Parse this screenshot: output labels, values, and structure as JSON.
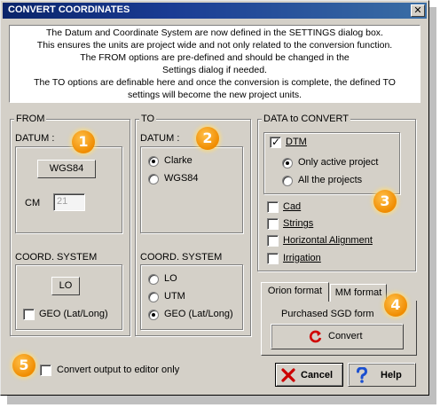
{
  "window": {
    "title": "CONVERT COORDINATES",
    "close_glyph": "✕"
  },
  "info": {
    "lines": [
      "The Datum and Coordinate System are now defined in the SETTINGS dialog box.",
      "This ensures the units are project wide and not only related to the conversion function.",
      "The FROM options are pre-defined and should be changed in the",
      "Settings dialog if needed.",
      "The TO options are definable here and once the conversion is complete, the defined TO",
      "settings will become the new project units."
    ]
  },
  "from": {
    "legend": "FROM",
    "datum_label": "DATUM :",
    "datum_button": "WGS84",
    "cm_label": "CM",
    "cm_value": "21",
    "coord_label": "COORD. SYSTEM",
    "coord_button": "LO",
    "geo_label": "GEO (Lat/Long)",
    "geo_checked": false
  },
  "to": {
    "legend": "TO",
    "datum_label": "DATUM :",
    "datum_options": [
      "Clarke",
      "WGS84"
    ],
    "datum_selected": "Clarke",
    "coord_label": "COORD. SYSTEM",
    "coord_options": [
      "LO",
      "UTM",
      "GEO (Lat/Long)"
    ],
    "coord_selected": "GEO (Lat/Long)"
  },
  "data": {
    "legend": "DATA to CONVERT",
    "dtm_label": "DTM",
    "dtm_checked": true,
    "scope_options": [
      "Only active project",
      "All the projects"
    ],
    "scope_selected": "Only active project",
    "items": [
      {
        "label": "Cad",
        "checked": false
      },
      {
        "label": "Strings",
        "checked": false
      },
      {
        "label": "Horizontal Alignment",
        "checked": false
      },
      {
        "label": "Irrigation",
        "checked": false
      }
    ]
  },
  "tabs": {
    "orion": "Orion format",
    "mm": "MM format",
    "active": "Orion format"
  },
  "purchased_text": "Purchased SGD form",
  "convert_label": "Convert",
  "editor_only_label": "Convert output to editor only",
  "editor_only_checked": false,
  "cancel_label": "Cancel",
  "help_label": "Help",
  "badges": [
    "1",
    "2",
    "3",
    "4",
    "5"
  ],
  "colors": {
    "title_bar": "#0a246a",
    "badge": "#f08c00",
    "dialog_bg": "#d4d0c8"
  },
  "icons": {
    "cancel": "red-x-icon",
    "help": "blue-question-icon",
    "convert": "red-refresh-icon"
  }
}
